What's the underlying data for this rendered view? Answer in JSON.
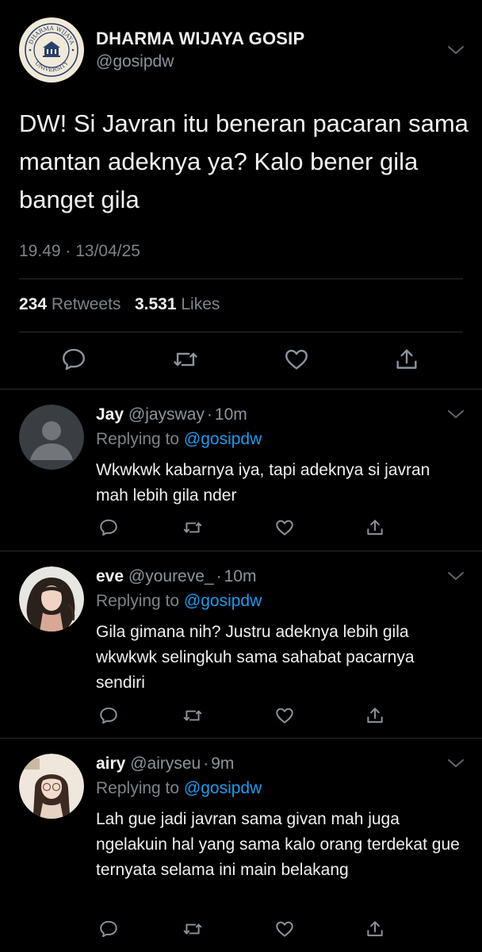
{
  "main_tweet": {
    "account_name": "DHARMA WIJAYA GOSIP",
    "handle": "@gosipdw",
    "text": "DW! Si Javran itu beneran pacaran sama mantan adeknya ya? Kalo bener gila banget gila",
    "timestamp": "19.49 · 13/04/25",
    "retweets_count": "234",
    "retweets_label": "Retweets",
    "likes_count": "3.531",
    "likes_label": "Likes",
    "logo_text_top": "DHARMA WIJAYA",
    "logo_text_bottom": "UNIVERSITY"
  },
  "replies": [
    {
      "name": "Jay",
      "handle": "@jaysway",
      "dot": "·",
      "time": "10m",
      "replying_prefix": "Replying to",
      "replying_to": "@gosipdw",
      "text": "Wkwkwk kabarnya iya, tapi adeknya si javran mah lebih gila nder"
    },
    {
      "name": "eve",
      "handle": "@youreve_",
      "dot": "·",
      "time": "10m",
      "replying_prefix": "Replying to",
      "replying_to": "@gosipdw",
      "text": "Gila gimana nih? Justru adeknya lebih gila wkwkwk selingkuh sama sahabat pacarnya sendiri"
    },
    {
      "name": "airy",
      "handle": "@airyseu",
      "dot": "·",
      "time": "9m",
      "replying_prefix": "Replying to",
      "replying_to": "@gosipdw",
      "text": "Lah gue jadi javran sama givan mah juga ngelakuin hal yang sama kalo orang terdekat gue ternyata selama ini main belakang"
    }
  ],
  "icons": {
    "reply": "reply-icon",
    "retweet": "retweet-icon",
    "like": "heart-icon",
    "share": "share-icon",
    "more": "chevron-down-icon"
  },
  "colors": {
    "background": "#000000",
    "text": "#f0f0f0",
    "secondary": "#8b949b",
    "link": "#1d9bf0",
    "divider": "#2a2d30"
  }
}
